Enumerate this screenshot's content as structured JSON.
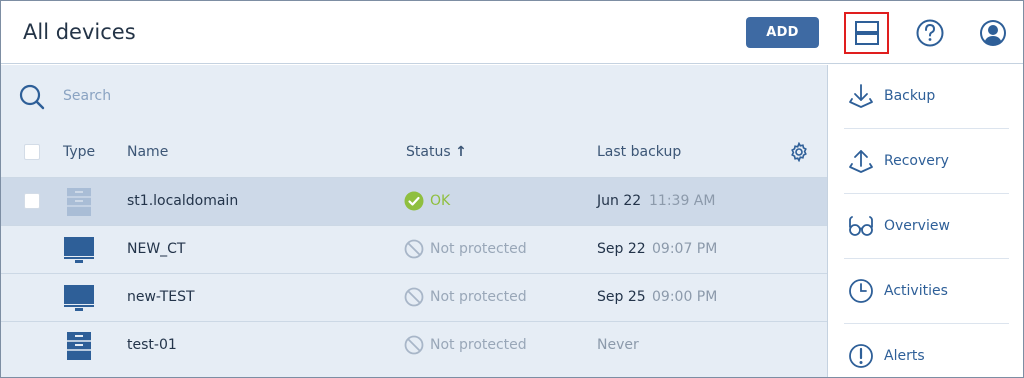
{
  "header": {
    "title": "All devices",
    "add_label": "ADD"
  },
  "search": {
    "placeholder": "Search",
    "value": ""
  },
  "table": {
    "columns": {
      "type": "Type",
      "name": "Name",
      "status": "Status",
      "status_sort": "↑",
      "last_backup": "Last backup"
    },
    "rows": [
      {
        "type_icon": "server-icon",
        "name": "st1.localdomain",
        "status": "OK",
        "status_icon": "check-circle-icon",
        "date": "Jun 22",
        "time": "11:39 AM",
        "selected": true
      },
      {
        "type_icon": "monitor-icon",
        "name": "NEW_CT",
        "status": "Not protected",
        "status_icon": "not-protected-icon",
        "date": "Sep 22",
        "time": "09:07 PM"
      },
      {
        "type_icon": "monitor-icon",
        "name": "new-TEST",
        "status": "Not protected",
        "status_icon": "not-protected-icon",
        "date": "Sep 25",
        "time": "09:00 PM"
      },
      {
        "type_icon": "server-icon",
        "name": "test-01",
        "status": "Not protected",
        "status_icon": "not-protected-icon",
        "date": "Never",
        "time": ""
      }
    ]
  },
  "side_panel": {
    "actions": [
      {
        "label": "Backup",
        "icon": "backup-icon"
      },
      {
        "label": "Recovery",
        "icon": "recovery-icon"
      },
      {
        "label": "Overview",
        "icon": "glasses-icon"
      },
      {
        "label": "Activities",
        "icon": "clock-icon"
      },
      {
        "label": "Alerts",
        "icon": "alert-icon"
      }
    ]
  },
  "colors": {
    "accent": "#3e6aa3",
    "selected_row": "#cdd9e8",
    "ok": "#8fbf3f",
    "muted": "#99a7b8",
    "highlight_box": "#e01e1e"
  }
}
